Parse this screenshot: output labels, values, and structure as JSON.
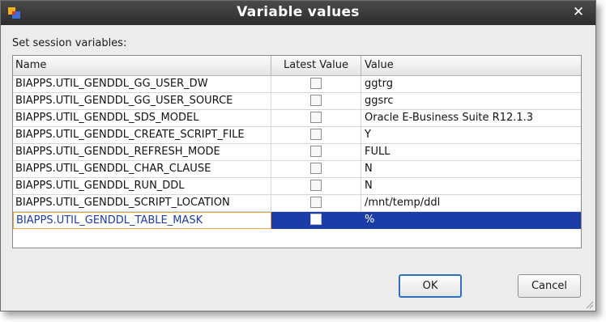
{
  "dialog": {
    "title": "Variable values",
    "close_icon": "close-icon",
    "app_icon": "oracle-app-icon",
    "instruction": "Set session variables:"
  },
  "table": {
    "columns": [
      "Name",
      "Latest Value",
      "Value"
    ],
    "rows": [
      {
        "name": "BIAPPS.UTIL_GENDDL_GG_USER_DW",
        "latest": false,
        "value": "ggtrg"
      },
      {
        "name": "BIAPPS.UTIL_GENDDL_GG_USER_SOURCE",
        "latest": false,
        "value": "ggsrc"
      },
      {
        "name": "BIAPPS.UTIL_GENDDL_SDS_MODEL",
        "latest": false,
        "value": "Oracle E-Business Suite R12.1.3"
      },
      {
        "name": "BIAPPS.UTIL_GENDDL_CREATE_SCRIPT_FILE",
        "latest": false,
        "value": "Y"
      },
      {
        "name": "BIAPPS.UTIL_GENDDL_REFRESH_MODE",
        "latest": false,
        "value": "FULL"
      },
      {
        "name": "BIAPPS.UTIL_GENDDL_CHAR_CLAUSE",
        "latest": false,
        "value": "N"
      },
      {
        "name": "BIAPPS.UTIL_GENDDL_RUN_DDL",
        "latest": false,
        "value": "N"
      },
      {
        "name": "BIAPPS.UTIL_GENDDL_SCRIPT_LOCATION",
        "latest": false,
        "value": "/mnt/temp/ddl"
      },
      {
        "name": "BIAPPS.UTIL_GENDDL_TABLE_MASK",
        "latest": false,
        "value": "%",
        "selected": true
      }
    ]
  },
  "buttons": {
    "ok": "OK",
    "cancel": "Cancel"
  },
  "colors": {
    "titlebar": "#3a3a3a",
    "selection": "#1c3ca8",
    "focus_border": "#e8a33d"
  }
}
